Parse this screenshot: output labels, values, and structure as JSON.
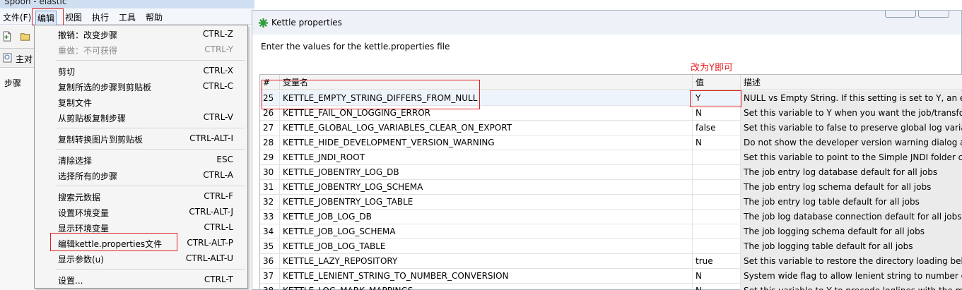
{
  "app": {
    "window_title": "Spoon - elastic",
    "menubar": [
      "文件(F)",
      "编辑",
      "视图",
      "执行",
      "工具",
      "帮助"
    ],
    "active_menu": "编辑",
    "main_tab": "主对",
    "side_tab": "步骤"
  },
  "edit_menu": {
    "groups": [
      [
        {
          "label": "撤销：改变步骤",
          "shortcut": "CTRL-Z",
          "enabled": true
        },
        {
          "label": "重做：不可获得",
          "shortcut": "CTRL-Y",
          "enabled": false
        }
      ],
      [
        {
          "label": "剪切",
          "shortcut": "CTRL-X",
          "enabled": true
        },
        {
          "label": "复制所选的步骤到剪贴板",
          "shortcut": "CTRL-C",
          "enabled": true
        },
        {
          "label": "复制文件",
          "shortcut": "",
          "enabled": true
        },
        {
          "label": "从剪贴板复制步骤",
          "shortcut": "CTRL-V",
          "enabled": true
        }
      ],
      [
        {
          "label": "复制转换图片到剪贴板",
          "shortcut": "CTRL-ALT-I",
          "enabled": true
        }
      ],
      [
        {
          "label": "清除选择",
          "shortcut": "ESC",
          "enabled": true
        },
        {
          "label": "选择所有的步骤",
          "shortcut": "CTRL-A",
          "enabled": true
        }
      ],
      [
        {
          "label": "搜索元数据",
          "shortcut": "CTRL-F",
          "enabled": true
        },
        {
          "label": "设置环境变量",
          "shortcut": "CTRL-ALT-J",
          "enabled": true
        },
        {
          "label": "显示环境变量",
          "shortcut": "CTRL-L",
          "enabled": true
        },
        {
          "label": "编辑kettle.properties文件",
          "shortcut": "CTRL-ALT-P",
          "enabled": true,
          "highlighted": true
        },
        {
          "label": "显示参数(u)",
          "shortcut": "CTRL-ALT-U",
          "enabled": true
        }
      ],
      [
        {
          "label": "设置...",
          "shortcut": "CTRL-T",
          "enabled": true
        }
      ]
    ]
  },
  "dialog": {
    "title": "Kettle properties",
    "prompt": "Enter the values for the kettle.properties file",
    "annotation": "改为Y即可",
    "columns": {
      "num": "#",
      "name": "变量名",
      "value": "值",
      "desc": "描述"
    },
    "rows": [
      {
        "num": "25",
        "name": "KETTLE_EMPTY_STRING_DIFFERS_FROM_NULL",
        "value": "Y",
        "desc": "NULL vs Empty String. If this setting is set to Y, an em"
      },
      {
        "num": "26",
        "name": "KETTLE_FAIL_ON_LOGGING_ERROR",
        "value": "N",
        "desc": "Set this variable to Y when you want the job/transform"
      },
      {
        "num": "27",
        "name": "KETTLE_GLOBAL_LOG_VARIABLES_CLEAR_ON_EXPORT",
        "value": "false",
        "desc": "Set this variable to false to preserve global log variab"
      },
      {
        "num": "28",
        "name": "KETTLE_HIDE_DEVELOPMENT_VERSION_WARNING",
        "value": "N",
        "desc": "Do not show the developer version warning dialog at"
      },
      {
        "num": "29",
        "name": "KETTLE_JNDI_ROOT",
        "value": "",
        "desc": "Set this variable to point to the Simple JNDI folder co"
      },
      {
        "num": "30",
        "name": "KETTLE_JOBENTRY_LOG_DB",
        "value": "",
        "desc": "The job entry log database default for all jobs"
      },
      {
        "num": "31",
        "name": "KETTLE_JOBENTRY_LOG_SCHEMA",
        "value": "",
        "desc": "The job entry log schema default for all jobs"
      },
      {
        "num": "32",
        "name": "KETTLE_JOBENTRY_LOG_TABLE",
        "value": "",
        "desc": "The job entry log table default for all jobs"
      },
      {
        "num": "33",
        "name": "KETTLE_JOB_LOG_DB",
        "value": "",
        "desc": "The job log database connection default for all jobs"
      },
      {
        "num": "34",
        "name": "KETTLE_JOB_LOG_SCHEMA",
        "value": "",
        "desc": "The job logging schema default for all jobs"
      },
      {
        "num": "35",
        "name": "KETTLE_JOB_LOG_TABLE",
        "value": "",
        "desc": "The job logging table default for all jobs"
      },
      {
        "num": "36",
        "name": "KETTLE_LAZY_REPOSITORY",
        "value": "true",
        "desc": "Set this variable to restore the directory loading beha"
      },
      {
        "num": "37",
        "name": "KETTLE_LENIENT_STRING_TO_NUMBER_CONVERSION",
        "value": "N",
        "desc": "System wide flag to allow lenient string to number co"
      },
      {
        "num": "38",
        "name": "KETTLE_LOG_MARK_MAPPINGS",
        "value": "N",
        "desc": "Set this variable to Y to precede loglines with the ma"
      }
    ]
  },
  "colors": {
    "annotation_red": "#e02020",
    "kettle_green": "#2e9a3a",
    "title_bar": "#cfdff1"
  },
  "icons": [
    "new-file-icon",
    "open-folder-icon",
    "kettle-logo-icon",
    "tab-icon"
  ]
}
